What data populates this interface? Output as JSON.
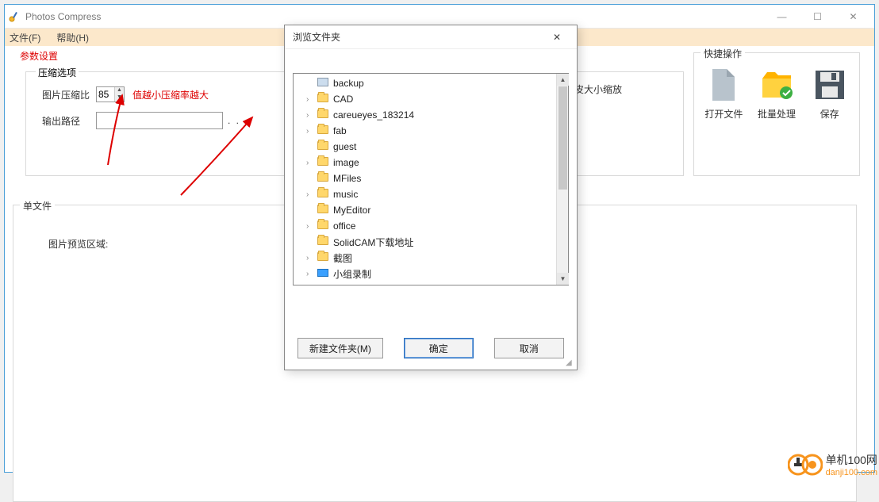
{
  "window": {
    "title": "Photos Compress",
    "minimize": "—",
    "maximize": "☐",
    "close": "✕"
  },
  "menu": {
    "file": "文件(F)",
    "help": "帮助(H)"
  },
  "params": {
    "section_title": "参数设置",
    "group_title": "压缩选项",
    "ratio_label": "图片压缩比",
    "ratio_value": "85",
    "ratio_hint": "值越小压缩率越大",
    "path_label": "输出路径",
    "path_value": "",
    "browse_dots": ". . .",
    "scale_hint_fragment": "皮大小缩放"
  },
  "quick": {
    "title": "快捷操作",
    "open": "打开文件",
    "batch": "批量处理",
    "save": "保存"
  },
  "single": {
    "title": "单文件",
    "preview_label": "图片预览区域:"
  },
  "dialog": {
    "title": "浏览文件夹",
    "close": "✕",
    "new_folder": "新建文件夹(M)",
    "ok": "确定",
    "cancel": "取消",
    "items": [
      {
        "name": "backup",
        "expandable": false,
        "icon": "printer"
      },
      {
        "name": "CAD",
        "expandable": true,
        "icon": "folder"
      },
      {
        "name": "careueyes_183214",
        "expandable": true,
        "icon": "folder"
      },
      {
        "name": "fab",
        "expandable": true,
        "icon": "folder"
      },
      {
        "name": "guest",
        "expandable": false,
        "icon": "folder"
      },
      {
        "name": "image",
        "expandable": true,
        "icon": "folder"
      },
      {
        "name": "MFiles",
        "expandable": false,
        "icon": "folder"
      },
      {
        "name": "music",
        "expandable": true,
        "icon": "folder"
      },
      {
        "name": "MyEditor",
        "expandable": false,
        "icon": "folder"
      },
      {
        "name": "office",
        "expandable": true,
        "icon": "folder"
      },
      {
        "name": "SolidCAM下载地址",
        "expandable": false,
        "icon": "folder"
      },
      {
        "name": "截图",
        "expandable": true,
        "icon": "folder"
      },
      {
        "name": "小组录制",
        "expandable": true,
        "icon": "monitor"
      }
    ]
  },
  "watermark": {
    "line1": "单机100网",
    "line2": "danji100.com"
  }
}
